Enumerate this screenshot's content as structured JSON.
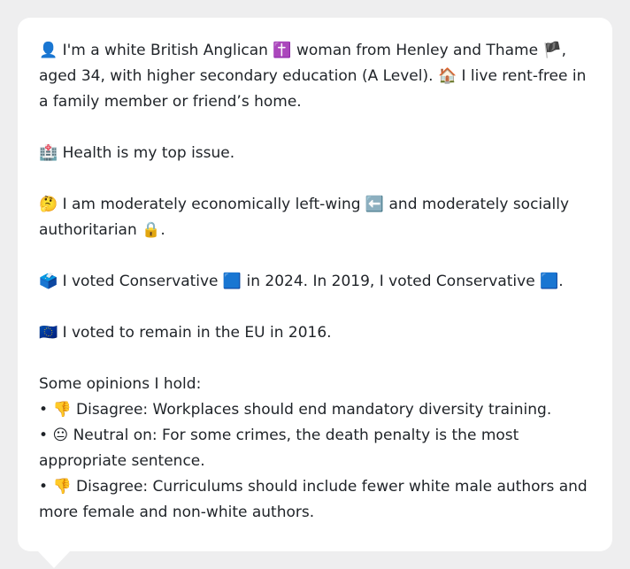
{
  "profile": {
    "intro": {
      "person_icon": "👤",
      "text_1": "I'm a white British Anglican",
      "religion_icon": "✝️",
      "text_2": "woman from Henley and Thame",
      "flag_icon": "🏴",
      "text_3": ", aged 34, with higher secondary education (A Level).",
      "home_icon": "🏠",
      "text_4": "I live rent-free in a family member or friend’s home."
    },
    "health": {
      "icon": "🏥",
      "text": "Health is my top issue."
    },
    "ideology": {
      "thinking_icon": "🤔",
      "text_1": "I am moderately economically left-wing",
      "left_arrow_icon": "⬅️",
      "text_2": "and moderately socially authoritarian",
      "lock_icon": "🔒",
      "text_3": "."
    },
    "vote": {
      "ballot_icon": "🗳️",
      "text_1": "I voted Conservative",
      "party_square_icon_1": "🟦",
      "text_2": "in 2024. In 2019, I voted Conservative",
      "party_square_icon_2": "🟦",
      "text_3": "."
    },
    "eu": {
      "eu_flag_icon": "🇪🇺",
      "text": "I voted to remain in the EU in 2016."
    },
    "opinions": {
      "heading": "Some opinions I hold:",
      "items": [
        {
          "bullet": "•",
          "icon": "👎",
          "text": "Disagree: Workplaces should end mandatory diversity training."
        },
        {
          "bullet": "•",
          "icon": "😐",
          "text": "Neutral on: For some crimes, the death penalty is the most appropriate sentence."
        },
        {
          "bullet": "•",
          "icon": "👎",
          "text": "Disagree: Curriculums should include fewer white male authors and more female and non-white authors."
        }
      ]
    }
  },
  "colors": {
    "background": "#eeeeef",
    "card": "#ffffff",
    "text": "#1f2328"
  }
}
